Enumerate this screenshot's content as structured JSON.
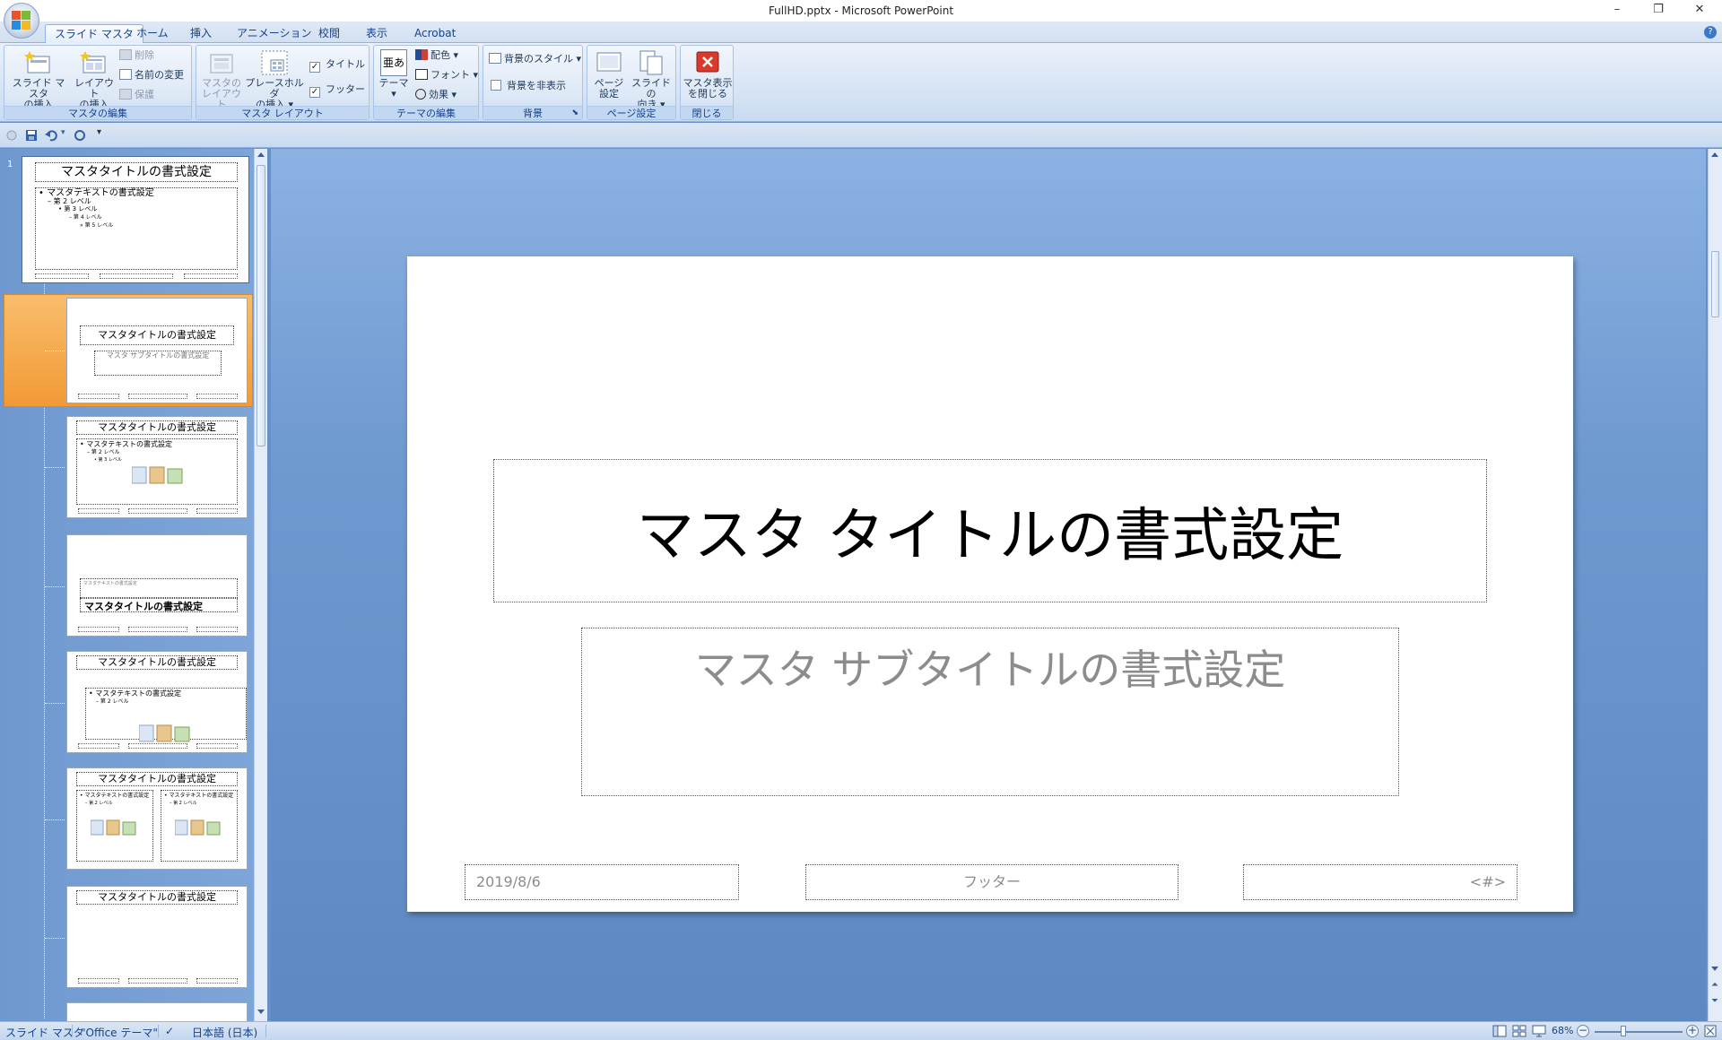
{
  "window": {
    "title": "FullHD.pptx - Microsoft PowerPoint",
    "minimize": "–",
    "restore": "❐",
    "close": "✕"
  },
  "tabs": [
    "スライド マスタ",
    "ホーム",
    "挿入",
    "アニメーション",
    "校閲",
    "表示",
    "Acrobat"
  ],
  "ribbon": {
    "groups": {
      "master_edit": "マスタの編集",
      "master_layout": "マスタ レイアウト",
      "theme_edit": "テーマの編集",
      "background": "背景",
      "page_setup": "ページ設定",
      "close": "閉じる"
    },
    "insert_master_l1": "スライド マスタ",
    "insert_master_l2": "の挿入",
    "insert_layout_l1": "レイアウト",
    "insert_layout_l2": "の挿入",
    "delete": "削除",
    "rename": "名前の変更",
    "preserve": "保護",
    "master_layout_l1": "マスタの",
    "master_layout_l2": "レイアウト",
    "insert_placeholder_l1": "プレースホルダ",
    "insert_placeholder_l2": "の挿入",
    "title_check": "タイトル",
    "footer_check": "フッター",
    "theme": "テーマ",
    "colors": "配色",
    "fonts": "フォント",
    "effects": "効果",
    "bg_styles": "背景のスタイル",
    "hide_bg": "背景を非表示",
    "page_setup_l1": "ページ",
    "page_setup_l2": "設定",
    "orientation_l1": "スライドの",
    "orientation_l2": "向き",
    "close_master_l1": "マスタ表示",
    "close_master_l2": "を閉じる",
    "theme_icon_text": "亜あ"
  },
  "slide_pane": {
    "master_number": "1",
    "thumbs": {
      "master_title": "マスタタイトルの書式設定",
      "master_text": "• マスタテキストの書式設定",
      "level2": "– 第 2 レベル",
      "level3": "• 第 3 レベル",
      "level4": "– 第 4 レベル",
      "level5": "» 第 5 レベル",
      "subtitle": "マスタ サブタイトルの書式設定",
      "layout_title": "マスタタイトルの書式設定",
      "section_small": "マスタテキストの書式設定"
    }
  },
  "slide": {
    "title": "マスタ タイトルの書式設定",
    "subtitle": "マスタ サブタイトルの書式設定",
    "date": "2019/8/6",
    "footer": "フッター",
    "number": "<#>"
  },
  "status": {
    "view": "スライド マスタ",
    "theme": "\"Office テーマ\"",
    "language": "日本語 (日本)",
    "zoom": "68%",
    "zoom_level": 0.68
  },
  "colors": {
    "selected_thumb": "#f5a848",
    "close_red": "#d93a2b"
  }
}
